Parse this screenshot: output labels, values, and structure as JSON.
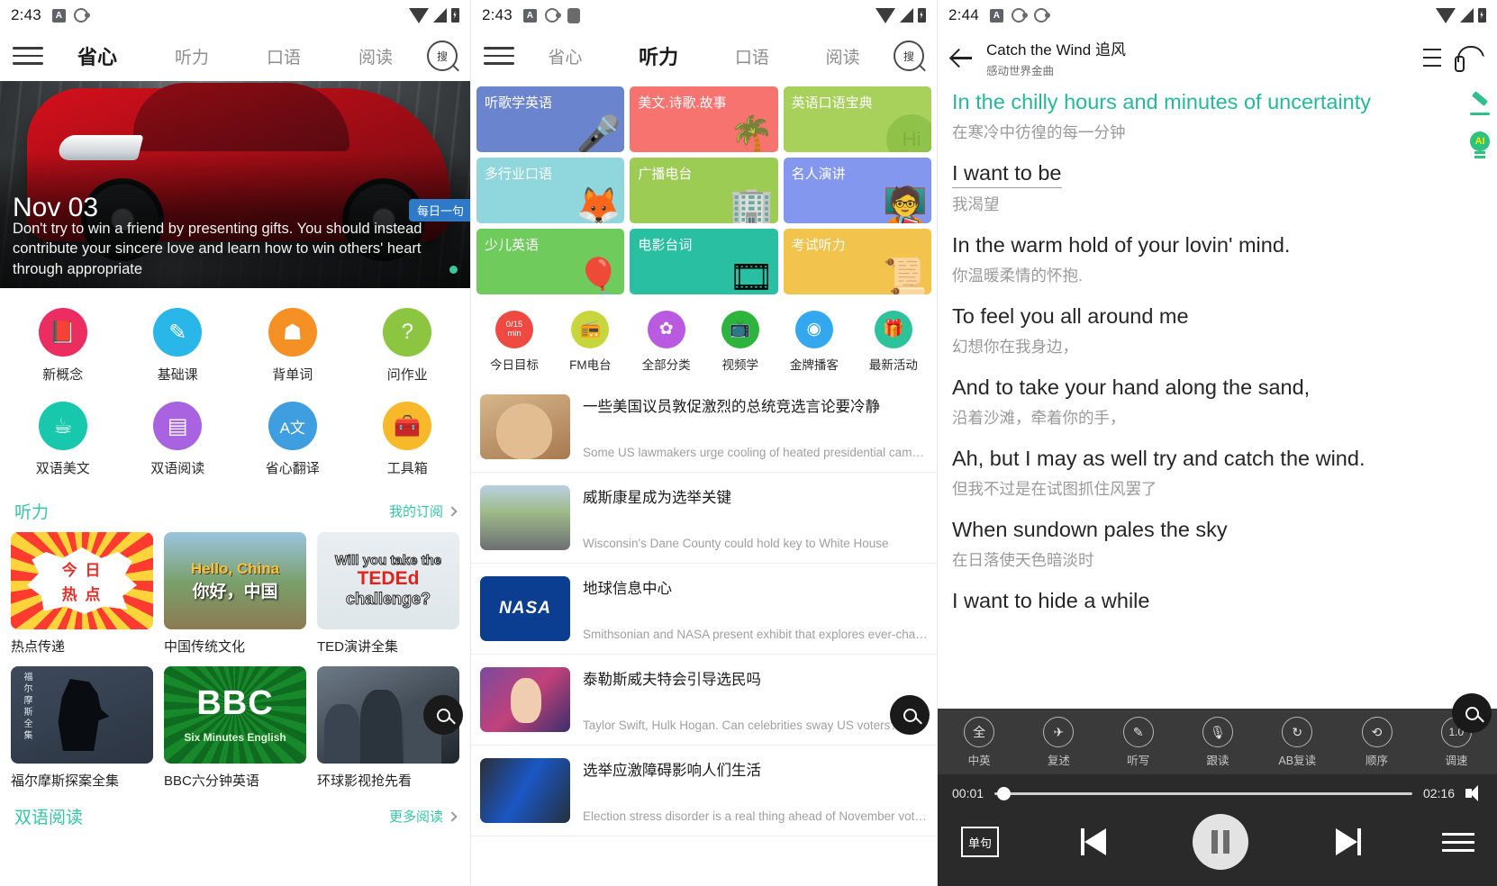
{
  "panel1": {
    "status": {
      "time": "2:43"
    },
    "nav": {
      "menu_icon": "hamburger-icon",
      "search_icon": "search-icon",
      "tabs": [
        {
          "label": "省心",
          "active": true
        },
        {
          "label": "听力",
          "active": false
        },
        {
          "label": "口语",
          "active": false
        },
        {
          "label": "阅读",
          "active": false
        }
      ]
    },
    "hero": {
      "date": "Nov 03",
      "badge": "每日一句",
      "quote": "Don't try to win a friend by presenting gifts. You should instead contribute your sincere love and learn how to win others' heart through appropriate"
    },
    "quick_icons": [
      {
        "label": "新概念",
        "icon": "book-icon",
        "color": "#ec2d62",
        "glyph": "▯"
      },
      {
        "label": "基础课",
        "icon": "pen-circle-icon",
        "color": "#29b6e8",
        "glyph": "✎"
      },
      {
        "label": "背单词",
        "icon": "brain-head-icon",
        "color": "#f59124",
        "glyph": "☗"
      },
      {
        "label": "问作业",
        "icon": "question-cloud-icon",
        "color": "#8cc540",
        "glyph": "?"
      },
      {
        "label": "双语美文",
        "icon": "coffee-cup-icon",
        "color": "#17c8ac",
        "glyph": "☕"
      },
      {
        "label": "双语阅读",
        "icon": "news-article-icon",
        "color": "#a963e0",
        "glyph": "▤"
      },
      {
        "label": "省心翻译",
        "icon": "translate-icon",
        "color": "#3f9ee0",
        "glyph": "A文"
      },
      {
        "label": "工具箱",
        "icon": "toolbox-icon",
        "color": "#f7b829",
        "glyph": "🧰"
      }
    ],
    "section_listening": {
      "title": "听力",
      "more": "我的订阅"
    },
    "listening_cards": [
      {
        "name": "热点传递",
        "art": "hot-topic-art",
        "l1": "今 日",
        "l2": "热 点"
      },
      {
        "name": "中国传统文化",
        "art": "great-wall-art",
        "l1": "Hello, China",
        "l2": "你好，中国"
      },
      {
        "name": "TED演讲全集",
        "art": "ted-ed-art",
        "l1": "Will you take the",
        "l2": "TEDEd",
        "l3": "challenge?"
      },
      {
        "name": "福尔摩斯探案全集",
        "art": "sherlock-art",
        "l1": "福尔摩斯全集"
      },
      {
        "name": "BBC六分钟英语",
        "art": "bbc-art",
        "l1": "BBC",
        "l2": "Six Minutes English"
      },
      {
        "name": "环球影视抢先看",
        "art": "tv-series-art",
        "l1": ""
      }
    ],
    "section_reading": {
      "title": "双语阅读",
      "more": "更多阅读"
    }
  },
  "panel2": {
    "status": {
      "time": "2:43"
    },
    "nav": {
      "menu_icon": "hamburger-icon",
      "search_icon": "search-icon",
      "tabs": [
        {
          "label": "省心",
          "active": false
        },
        {
          "label": "听力",
          "active": true
        },
        {
          "label": "口语",
          "active": false
        },
        {
          "label": "阅读",
          "active": false
        }
      ]
    },
    "tiles": [
      {
        "label": "听歌学英语",
        "color": "#6a84cd",
        "art": "microphone-music-icon",
        "glyph": "🎤"
      },
      {
        "label": "美文.诗歌.故事",
        "color": "#f7736f",
        "art": "palm-tree-icon",
        "glyph": "🌴"
      },
      {
        "label": "英语口语宝典",
        "color": "#a8d15c",
        "art": "hi-bubble-icon",
        "glyph": "Hi"
      },
      {
        "label": "多行业口语",
        "color": "#8fd7dd",
        "art": "fox-icon",
        "glyph": "🦊"
      },
      {
        "label": "广播电台",
        "color": "#9ccc54",
        "art": "radio-building-icon",
        "glyph": "🏢"
      },
      {
        "label": "名人演讲",
        "color": "#8497ef",
        "art": "speaker-podium-icon",
        "glyph": "🗣"
      },
      {
        "label": "少儿英语",
        "color": "#6fcb5c",
        "art": "balloons-icon",
        "glyph": "🎈"
      },
      {
        "label": "电影台词",
        "color": "#28bfa2",
        "art": "film-reel-icon",
        "glyph": "🎞"
      },
      {
        "label": "考试听力",
        "color": "#f2c košt"
      }
    ],
    "tiles_fixed": [
      {
        "label": "听歌学英语",
        "color": "#6a84cd",
        "art": "microphone-music-icon",
        "glyph": "🎤"
      },
      {
        "label": "美文.诗歌.故事",
        "color": "#f7736f",
        "art": "palm-tree-icon",
        "glyph": "🌴"
      },
      {
        "label": "英语口语宝典",
        "color": "#a8d15c",
        "art": "hi-bubble-icon",
        "glyph": "Hi"
      },
      {
        "label": "多行业口语",
        "color": "#8fd7dd",
        "art": "fox-icon",
        "glyph": "🦊"
      },
      {
        "label": "广播电台",
        "color": "#9ccc54",
        "art": "radio-building-icon",
        "glyph": "🏢"
      },
      {
        "label": "名人演讲",
        "color": "#8497ef",
        "art": "speaker-podium-icon",
        "glyph": "🗣"
      },
      {
        "label": "少儿英语",
        "color": "#6fcb5c",
        "art": "balloons-icon",
        "glyph": "🎈"
      },
      {
        "label": "电影台词",
        "color": "#28bfa2",
        "art": "film-reel-icon",
        "glyph": "🎞"
      },
      {
        "label": "考试听力",
        "color": "#f2c44e",
        "art": "diploma-icon",
        "glyph": "📜"
      }
    ],
    "func_row": [
      {
        "label": "今日目标",
        "icon": "daily-goal-icon",
        "color": "#ef4a42",
        "value": "0/15",
        "unit": "min"
      },
      {
        "label": "FM电台",
        "icon": "radio-icon",
        "color": "#c8d63e",
        "glyph": "📻"
      },
      {
        "label": "全部分类",
        "icon": "grid-categories-icon",
        "color": "#b95ae0",
        "glyph": "✿"
      },
      {
        "label": "视频学",
        "icon": "tv-video-icon",
        "color": "#2cb43c",
        "glyph": "📺"
      },
      {
        "label": "金牌播客",
        "icon": "podcast-icon",
        "color": "#33a8ee",
        "glyph": "◉"
      },
      {
        "label": "最新活动",
        "icon": "gift-icon",
        "color": "#2cc29a",
        "glyph": "🎁"
      }
    ],
    "news": [
      {
        "zh": "一些美国议员敦促激烈的总统竞选言论要冷静",
        "en": "Some US lawmakers urge cooling of heated presidential campai…",
        "thumb": "trump-photo"
      },
      {
        "zh": "威斯康星成为选举关键",
        "en": "Wisconsin's Dane County could hold key to White House",
        "thumb": "wisconsin-photo"
      },
      {
        "zh": "地球信息中心",
        "en": "Smithsonian and NASA present exhibit that explores ever-changi…",
        "thumb": "nasa-logo"
      },
      {
        "zh": "泰勒斯威夫特会引导选民吗",
        "en": "Taylor Swift, Hulk Hogan. Can celebrities sway US voters?",
        "thumb": "taylor-swift-photo"
      },
      {
        "zh": "选举应激障碍影响人们生活",
        "en": "Election stress disorder is a real thing ahead of November voting",
        "thumb": "election-photo"
      }
    ]
  },
  "panel3": {
    "status": {
      "time": "2:44"
    },
    "header": {
      "back_icon": "back-arrow-icon",
      "title": "Catch the Wind 追风",
      "subtitle": "感动世界金曲",
      "list_icon": "playlist-icon",
      "headphone_icon": "headphone-icon"
    },
    "side_tools": [
      {
        "icon": "pencil-icon"
      },
      {
        "icon": "ai-bulb-icon",
        "label": "AI"
      }
    ],
    "lyrics": [
      {
        "en": "In the chilly hours and minutes of uncertainty",
        "zh": "在寒冷中彷徨的每一分钟",
        "current": true
      },
      {
        "en": "I want to be",
        "zh": "我渴望",
        "current": false
      },
      {
        "en": "In the warm hold of your lovin' mind.",
        "zh": "你温暖柔情的怀抱.",
        "current": false
      },
      {
        "en": "To feel you all around me",
        "zh": "幻想你在我身边，",
        "current": false
      },
      {
        "en": "And to take your hand along the sand,",
        "zh": "沿着沙滩，牵着你的手，",
        "current": false
      },
      {
        "en": "Ah, but I may as well try and catch the wind.",
        "zh": "但我不过是在试图抓住风罢了",
        "current": false
      },
      {
        "en": "When sundown pales the sky",
        "zh": "在日落使天色暗淡时",
        "current": false
      },
      {
        "en": "I want to hide a while",
        "zh": "",
        "current": false
      }
    ],
    "player": {
      "tools": [
        {
          "label": "中英",
          "icon": "full-text-icon",
          "glyph": "全"
        },
        {
          "label": "复述",
          "icon": "retell-plane-icon",
          "glyph": "✈"
        },
        {
          "label": "听写",
          "icon": "dictation-pencil-icon",
          "glyph": "✎"
        },
        {
          "label": "跟读",
          "icon": "microphone-icon",
          "glyph": "🎙"
        },
        {
          "label": "AB复读",
          "icon": "ab-repeat-icon",
          "glyph": "↻"
        },
        {
          "label": "顺序",
          "icon": "order-icon",
          "glyph": "⟲"
        },
        {
          "label": "调速",
          "icon": "speed-icon",
          "glyph": "1.0"
        }
      ],
      "current_time": "00:01",
      "total_time": "02:16",
      "progress_percent": 1,
      "volume_icon": "volume-icon",
      "loop_label": "单句",
      "prev_icon": "previous-track-icon",
      "play_icon": "pause-icon",
      "next_icon": "next-track-icon",
      "menu_icon": "menu-icon"
    }
  },
  "floating": {
    "search_icon": "search-fab-icon"
  }
}
